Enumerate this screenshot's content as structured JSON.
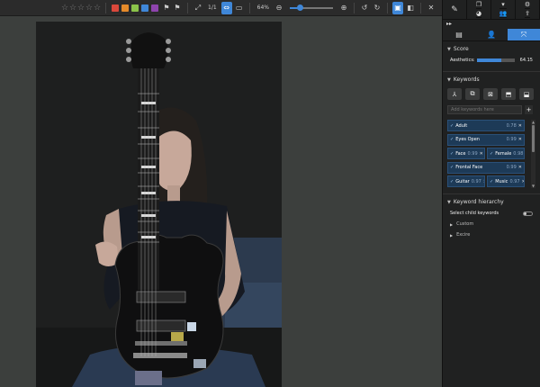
{
  "toolbar": {
    "rating_stars": [
      "☆",
      "☆",
      "☆",
      "☆",
      "☆"
    ],
    "color_labels": [
      "#d9483b",
      "#e58a2a",
      "#8bc34a",
      "#3f87d8",
      "#8e44ad"
    ],
    "page_counter": "1/1",
    "zoom_value": "64%",
    "zoom_out_icon": "magnify-minus-icon",
    "zoom_in_icon": "magnify-plus-icon"
  },
  "sidebar": {
    "expand_label": "▸▸",
    "score": {
      "title": "Score",
      "aesthetics_label": "Aesthetics:",
      "aesthetics_value": "64.15",
      "aesthetics_fraction": 0.6415
    },
    "keywords": {
      "title": "Keywords",
      "placeholder": "Add keywords here",
      "add_label": "+",
      "items": [
        [
          {
            "name": "Adult",
            "conf": "0.78"
          }
        ],
        [
          {
            "name": "Eyes Open",
            "conf": "0.99"
          }
        ],
        [
          {
            "name": "Face",
            "conf": "0.99"
          },
          {
            "name": "Female",
            "conf": "0.98"
          }
        ],
        [
          {
            "name": "Frontal Face",
            "conf": "0.99"
          }
        ],
        [
          {
            "name": "Guitar",
            "conf": "0.97"
          },
          {
            "name": "Music",
            "conf": "0.97"
          }
        ]
      ]
    },
    "hierarchy": {
      "title": "Keyword hierarchy",
      "select_child_label": "Select child keywords",
      "tree": [
        "Custom",
        "Excire"
      ]
    }
  },
  "accent": "#3f87d8"
}
